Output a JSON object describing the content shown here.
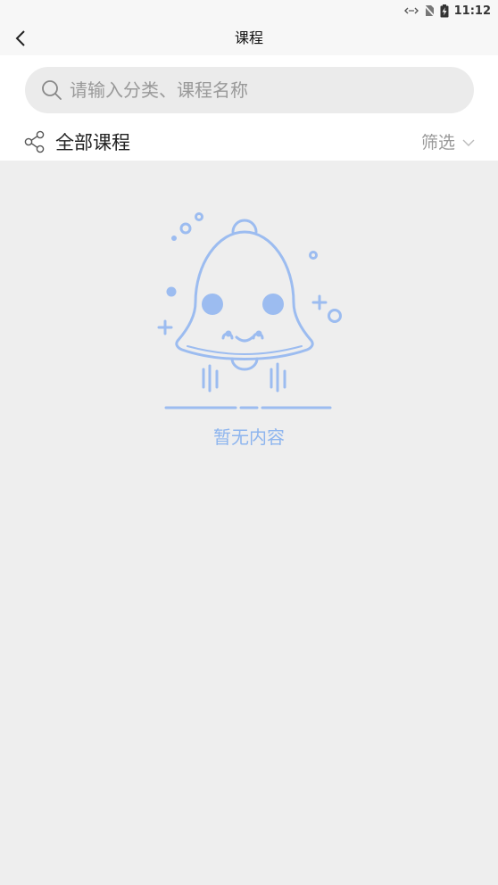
{
  "status_bar": {
    "time": "11:12"
  },
  "header": {
    "title": "课程"
  },
  "search": {
    "placeholder": "请输入分类、课程名称",
    "value": ""
  },
  "filter_bar": {
    "all_label": "全部课程",
    "filter_label": "筛选"
  },
  "empty_state": {
    "message": "暂无内容"
  },
  "colors": {
    "accent": "#8eb5ee",
    "bell_stroke": "#9cbcf0",
    "background": "#eeeeee"
  }
}
